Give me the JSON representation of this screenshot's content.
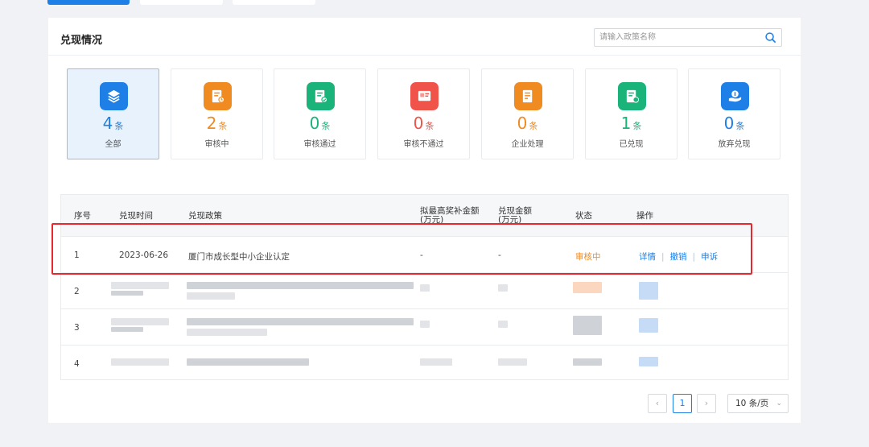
{
  "card": {
    "title": "兑现情况"
  },
  "search": {
    "placeholder": "请输入政策名称"
  },
  "stats": [
    {
      "count": "4",
      "unit": "条",
      "label": "全部",
      "color": "#1e7fe6",
      "icon": "layers-icon"
    },
    {
      "count": "2",
      "unit": "条",
      "label": "审核中",
      "color": "#f08b22",
      "icon": "document-pending-icon"
    },
    {
      "count": "0",
      "unit": "条",
      "label": "审核通过",
      "color": "#1ab37a",
      "icon": "document-approved-icon"
    },
    {
      "count": "0",
      "unit": "条",
      "label": "审核不通过",
      "color": "#f0534a",
      "icon": "document-rejected-icon"
    },
    {
      "count": "0",
      "unit": "条",
      "label": "企业处理",
      "color": "#f08b22",
      "icon": "document-processing-icon"
    },
    {
      "count": "1",
      "unit": "条",
      "label": "已兑现",
      "color": "#1ab37a",
      "icon": "document-cashed-icon"
    },
    {
      "count": "0",
      "unit": "条",
      "label": "放弃兑现",
      "color": "#1e7fe6",
      "icon": "hand-coin-icon"
    }
  ],
  "table": {
    "columns": [
      "序号",
      "兑现时间",
      "兑现政策",
      "拟最高奖补金额",
      "(万元)",
      "兑现金额",
      "(万元)",
      "状态",
      "操作"
    ],
    "rows": [
      {
        "index": "1",
        "date": "2023-06-26",
        "policy": "厦门市成长型中小企业认定",
        "max_amount": "-",
        "amount": "-",
        "status": "审核中",
        "ops": [
          "详情",
          "撤销",
          "申诉"
        ]
      },
      {
        "index": "2"
      },
      {
        "index": "3"
      },
      {
        "index": "4"
      }
    ],
    "op_separator": "|"
  },
  "pagination": {
    "prev": "‹",
    "current": "1",
    "next": "›",
    "page_size": "10 条/页",
    "dropdown_icon": "chevron-down-icon"
  },
  "colors": {
    "primary": "#1e7fe6",
    "pending": "#f08b22",
    "highlight": "#e8282d"
  }
}
